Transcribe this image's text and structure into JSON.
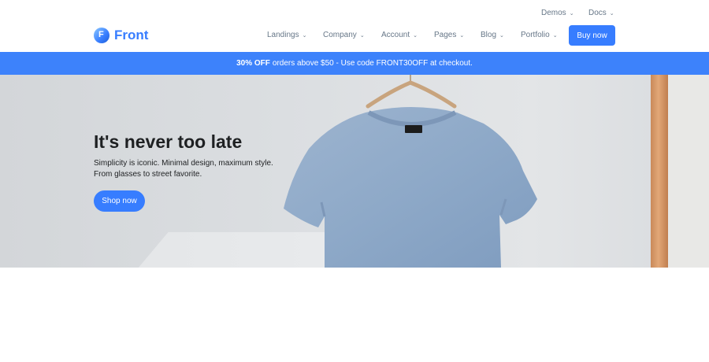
{
  "topbar": {
    "links": [
      {
        "label": "Demos",
        "icon": "chevron-down-icon"
      },
      {
        "label": "Docs",
        "icon": "chevron-down-icon"
      }
    ]
  },
  "header": {
    "logo_text": "Front",
    "nav": [
      {
        "label": "Landings"
      },
      {
        "label": "Company"
      },
      {
        "label": "Account"
      },
      {
        "label": "Pages"
      },
      {
        "label": "Blog"
      },
      {
        "label": "Portfolio"
      }
    ],
    "cta_label": "Buy now"
  },
  "promo": {
    "highlight": "30% OFF",
    "text": "orders above $50 - Use code FRONT30OFF at checkout."
  },
  "hero": {
    "title": "It's never too late",
    "subtitle_line1": "Simplicity is iconic. Minimal design, maximum style.",
    "subtitle_line2": "From glasses to street favorite.",
    "button_label": "Shop now"
  },
  "colors": {
    "primary": "#377dff",
    "promo_bg": "#3d82fb",
    "text_dark": "#1e2022",
    "text_muted": "#677788"
  }
}
